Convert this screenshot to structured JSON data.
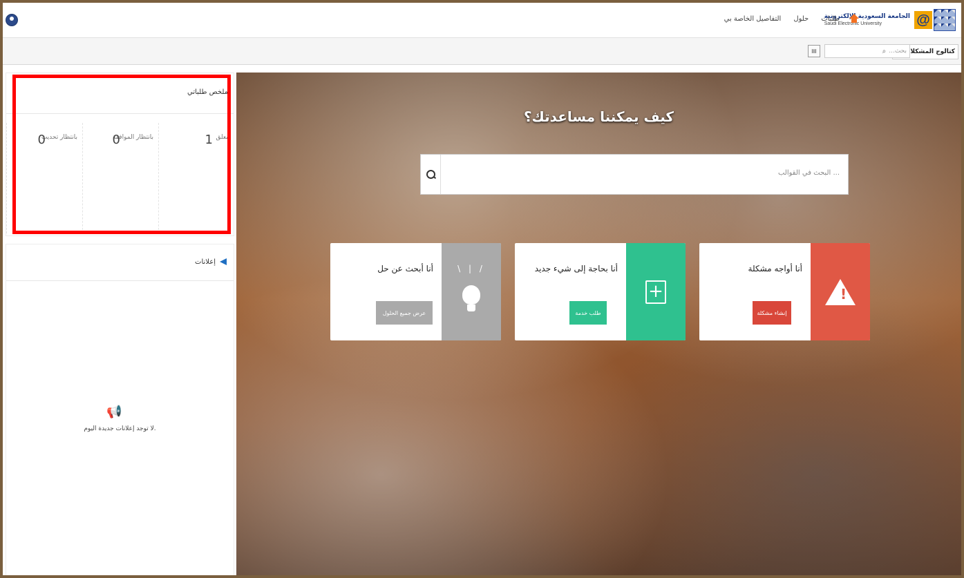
{
  "topnav": {
    "logo_ar": "الجامعة السعودية الإلكترونية",
    "logo_en": "Saudi Electronic University",
    "links": [
      "طلبات",
      "حلول",
      "التفاصيل الخاصة بي"
    ]
  },
  "searchrow": {
    "scope_label": "كتالوج المشكلات",
    "search_placeholder": "بحث..."
  },
  "summary": {
    "title": "ملخص طلباتي",
    "stats": [
      {
        "label": "معلق",
        "value": "1"
      },
      {
        "label": "بانتظار الموافقة",
        "value": "0"
      },
      {
        "label": "بانتظار تحديث",
        "value": "0"
      }
    ]
  },
  "announcements": {
    "title": "إعلانات",
    "empty_text": "لا توجد إعلانات جديدة اليوم."
  },
  "hero": {
    "title": "كيف يمكننا مساعدتك؟",
    "search_placeholder": "البحث في القوالب ..."
  },
  "cards": {
    "problem": {
      "title": "أنا أواجه مشكلة",
      "button": "إنشاء مشكلة",
      "icon": "warning-icon",
      "color": "#e05845"
    },
    "new": {
      "title": "أنا بحاجة إلى شيء جديد",
      "button": "طلب خدمة",
      "icon": "plus-icon",
      "color": "#2fc18f"
    },
    "solution": {
      "title": "أنا أبحث عن حل",
      "button": "عرض جميع الحلول",
      "icon": "lightbulb-icon",
      "color": "#aaaaaa"
    }
  },
  "highlight_color": "#ff0000"
}
